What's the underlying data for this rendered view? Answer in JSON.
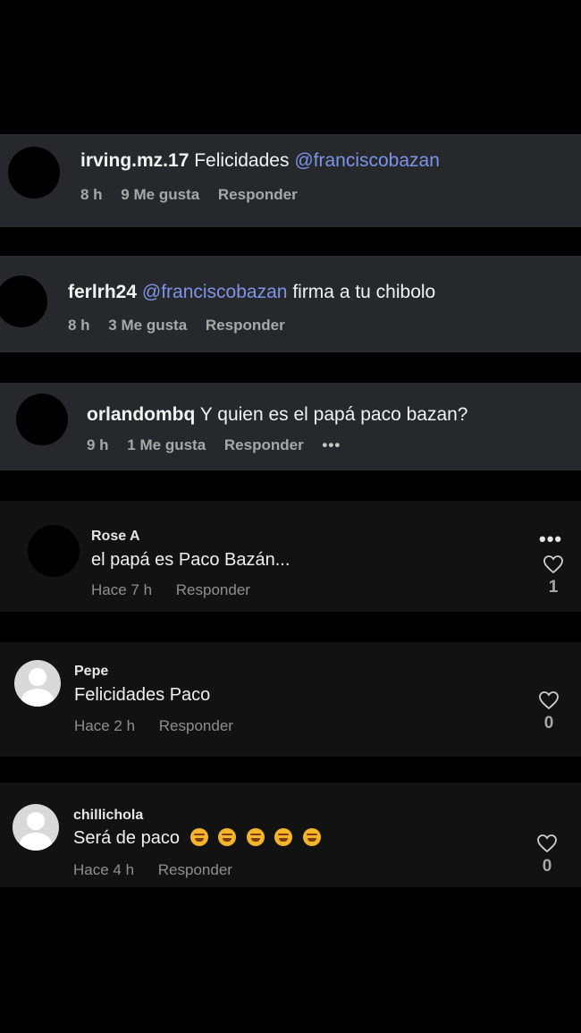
{
  "comments_ig": [
    {
      "username": "irving.mz.17",
      "text": "Felicidades",
      "mention": "@franciscobazan",
      "text_after": "",
      "time": "8 h",
      "likes": "9 Me gusta",
      "reply": "Responder"
    },
    {
      "username": "ferlrh24",
      "text": "",
      "mention": "@franciscobazan",
      "text_after": "firma a tu chibolo",
      "time": "8 h",
      "likes": "3 Me gusta",
      "reply": "Responder"
    },
    {
      "username": "orlandombq",
      "text": "Y quien es el papá paco bazan?",
      "mention": "",
      "text_after": "",
      "time": "9 h",
      "likes": "1 Me gusta",
      "reply": "Responder",
      "more": "•••"
    }
  ],
  "comments_tt": [
    {
      "username": "Rose A",
      "text": "el papá es Paco Bazán...",
      "time": "Hace 7 h",
      "reply": "Responder",
      "likes": "1",
      "more": "•••"
    },
    {
      "username": "Pepe",
      "text": "Felicidades Paco",
      "time": "Hace 2 h",
      "reply": "Responder",
      "likes": "0"
    },
    {
      "username": "chillichola",
      "text": "Será de paco",
      "time": "Hace 4 h",
      "reply": "Responder",
      "likes": "0",
      "emoji_names": [
        "winking-face-with-tongue-emoji",
        "rolling-laughing-emoji",
        "rolling-laughing-emoji",
        "rolling-laughing-emoji",
        "rolling-laughing-emoji"
      ]
    }
  ]
}
